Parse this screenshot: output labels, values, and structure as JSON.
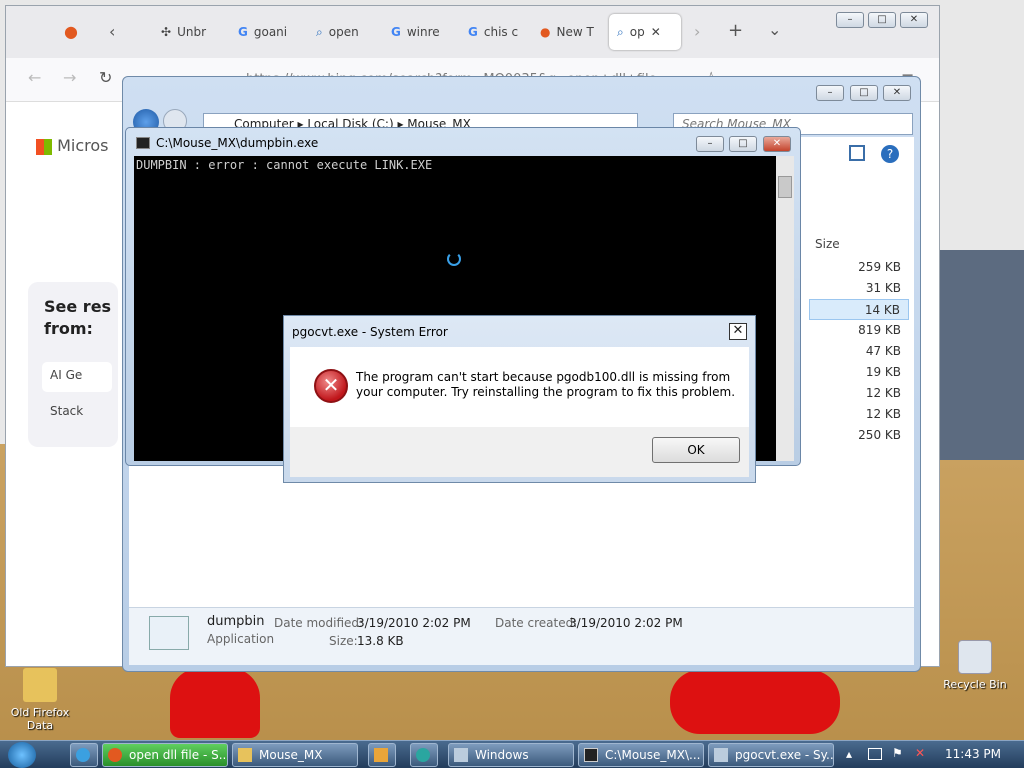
{
  "browser": {
    "tabs": [
      {
        "label": "Unbr"
      },
      {
        "label": "goani"
      },
      {
        "label": "open"
      },
      {
        "label": "winre"
      },
      {
        "label": "chis c"
      },
      {
        "label": "New T"
      },
      {
        "label": "op"
      }
    ],
    "url": "https://www.bing.com/search?form=MO0035&q=open+dll+file",
    "bing_logo": "Micros",
    "see_results_title": "See res from:",
    "ai_item": "AI Ge",
    "stack_item": "Stack"
  },
  "explorer": {
    "breadcrumb": [
      "Computer",
      "Local Disk (C:)",
      "Mouse_MX"
    ],
    "search_placeholder": "Search Mouse_MX",
    "size_header": "Size",
    "sizes": [
      "259 KB",
      "31 KB",
      "14 KB",
      "819 KB",
      "47 KB",
      "19 KB",
      "12 KB",
      "12 KB",
      "250 KB"
    ],
    "selected_index": 2,
    "details": {
      "name": "dumpbin",
      "type": "Application",
      "modified_label": "Date modified:",
      "modified": "3/19/2010 2:02 PM",
      "created_label": "Date created:",
      "created": "3/19/2010 2:02 PM",
      "size_label": "Size:",
      "size": "13.8 KB"
    }
  },
  "console": {
    "title": "C:\\Mouse_MX\\dumpbin.exe",
    "output": "DUMPBIN : error : cannot execute LINK.EXE"
  },
  "dialog": {
    "title": "pgocvt.exe - System Error",
    "message": "The program can't start because pgodb100.dll is missing from your computer. Try reinstalling the program to fix this problem.",
    "ok_label": "OK",
    "icon": "error-icon"
  },
  "desktop": {
    "icons": [
      {
        "label": "Old Firefox Data"
      },
      {
        "label": "Recycle Bin"
      }
    ]
  },
  "taskbar": {
    "items": [
      {
        "label": "open dll file - S..."
      },
      {
        "label": "Mouse_MX"
      },
      {
        "label": "Windows"
      },
      {
        "label": "C:\\Mouse_MX\\..."
      },
      {
        "label": "pgocvt.exe - Sy..."
      }
    ],
    "clock": "11:43 PM"
  }
}
